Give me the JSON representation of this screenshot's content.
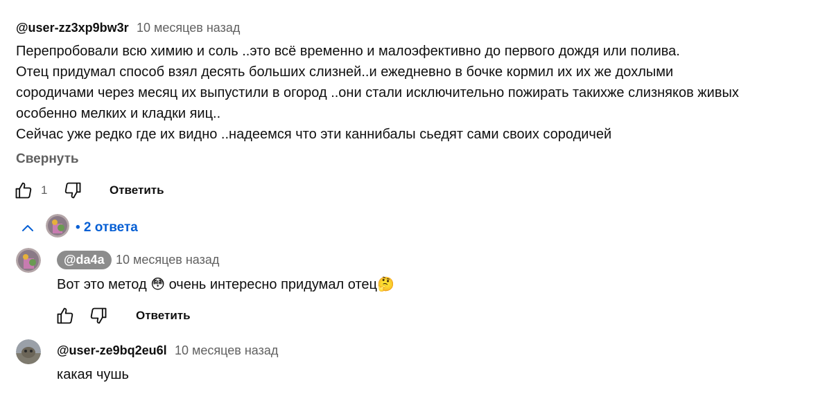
{
  "comment": {
    "author": "@user-zz3xp9bw3r",
    "time": "10 месяцев назад",
    "lines": [
      "Перепробовали всю химию и соль ..это всё временно и малоэфективно до первого дождя или полива.",
      "Отец придумал способ взял десять больших слизней..и ежедневно в бочке кормил их их же дохлыми",
      "сородичами через месяц их выпустили в огород  ..они стали исключительно пожирать такихже слизняков живых",
      "особенно мелких и кладки яиц..",
      "Сейчас уже редко где их видно  ..надеемся что эти каннибалы сьедят сами своих сородичей"
    ],
    "collapse_label": "Свернуть",
    "like_count": "1",
    "reply_label": "Ответить"
  },
  "replies_toggle": {
    "label": "• 2 ответа"
  },
  "replies": [
    {
      "author": "@da4a",
      "time": "10 месяцев назад",
      "text_a": "Вот это метод",
      "emoji_a": "😳",
      "text_b": "очень интересно придумал отец",
      "emoji_b": "🤔",
      "reply_label": "Ответить"
    },
    {
      "author": "@user-ze9bq2eu6l",
      "time": "10 месяцев назад",
      "text": "какая чушь"
    }
  ]
}
